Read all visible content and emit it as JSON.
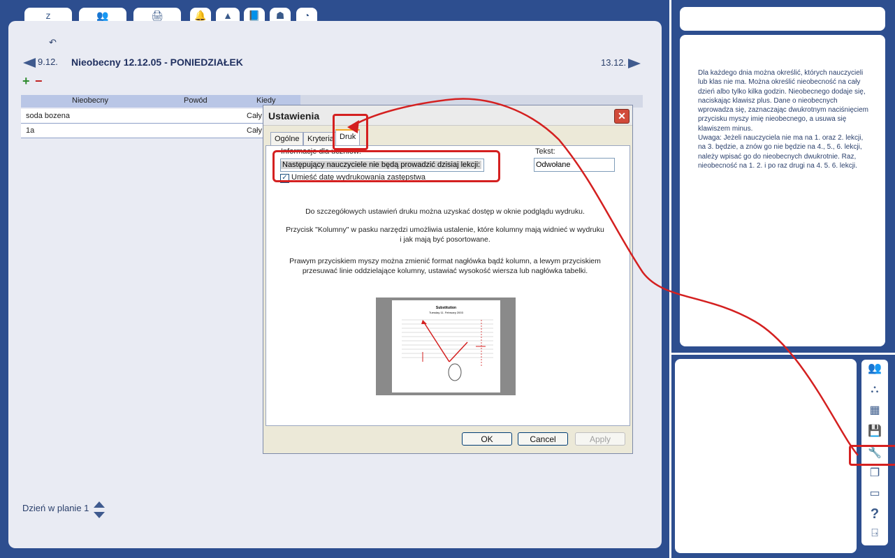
{
  "main": {
    "undo_symbol": "↶",
    "prev_day": "9.12.",
    "next_day": "13.12.",
    "title": "Nieobecny 12.12.05 - PONIEDZIAŁEK",
    "plus": "+",
    "minus": "−",
    "table": {
      "headers": [
        "Nieobecny",
        "Powód",
        "Kiedy"
      ],
      "rows": [
        {
          "name": "soda bozena",
          "when": "Cały"
        },
        {
          "name": "1a",
          "when": "Cały"
        }
      ]
    },
    "day_plan": "Dzień w planie 1"
  },
  "tabs": [
    {
      "icon": "sleep-icon",
      "symbol": "z"
    },
    {
      "icon": "teachers-icon",
      "symbol": "👥"
    },
    {
      "icon": "printer-icon",
      "symbol": "🖨"
    },
    {
      "icon": "bell-icon",
      "symbol": "🔔"
    },
    {
      "icon": "desk-icon",
      "symbol": "▲"
    },
    {
      "icon": "book-icon",
      "symbol": "📘"
    },
    {
      "icon": "person-icon",
      "symbol": "☗"
    },
    {
      "icon": "clock-icon",
      "symbol": "◔"
    }
  ],
  "dialog": {
    "title": "Ustawienia",
    "close": "✕",
    "tabs": [
      "Ogólne",
      "Kryteria",
      "Druk"
    ],
    "info_label": "Informacje dla uczniów:",
    "info_value": "Następujący nauczyciele nie będą prowadzić dzisiaj lekcji:",
    "tekst_label": "Tekst:",
    "tekst_value": "Odwołane",
    "checkbox_label": "Umieść datę wydrukowania zastępstwa",
    "checkbox_checked": true,
    "checkbox_mark": "✓",
    "para1": "Do szczegółowych ustawień druku można uzyskać dostęp w oknie podglądu wydruku.",
    "para2": "Przycisk \"Kolumny\" w pasku narzędzi umożliwia ustalenie, które kolumny mają widnieć w wydruku i jak mają być posortowane.",
    "para3": "Prawym przyciskiem myszy można zmienić format nagłówka bądź kolumn, a lewym przyciskiem przesuwać linie oddzielające kolumny, ustawiać wysokość wiersza lub nagłówka tabelki.",
    "preview_title": "Substitution",
    "preview_subtitle": "Tuesday 11. February 2003",
    "ok": "OK",
    "cancel": "Cancel",
    "apply": "Apply"
  },
  "help": {
    "text": "Dla każdego dnia można określić, których nauczycieli lub klas nie ma. Można określić nieobecność na cały dzień albo tylko kilka godzin. Nieobecnego dodaje się, naciskając klawisz plus. Dane o nieobecnych wprowadza się, zaznaczając dwukrotnym naciśnięciem przycisku myszy imię nieobecnego, a usuwa się klawiszem minus.\n Uwaga: Jeżeli nauczyciela nie ma na 1. oraz 2. lekcji, na 3. będzie, a znów go nie będzie na 4., 5., 6. lekcji, należy wpisać go do nieobecnych dwukrotnie. Raz, nieobecność na 1. 2. i po raz drugi na 4. 5. 6. lekcji."
  },
  "toolbar": [
    {
      "icon": "teachers-icon",
      "symbol": "👥"
    },
    {
      "icon": "classes-icon",
      "symbol": "⛬"
    },
    {
      "icon": "table-icon",
      "symbol": "▦"
    },
    {
      "icon": "save-icon",
      "symbol": "💾"
    },
    {
      "icon": "settings-tools-icon",
      "symbol": "🔧"
    },
    {
      "icon": "windows-icon",
      "symbol": "❐"
    },
    {
      "icon": "window-icon",
      "symbol": "▭"
    },
    {
      "icon": "help-icon",
      "symbol": "?"
    },
    {
      "icon": "exit-icon",
      "symbol": "⍈"
    }
  ],
  "colors": {
    "background": "#2d4e8f",
    "annotation": "#d42020",
    "title_text": "#1f2f5f",
    "active_tab_accent": "#f5a623"
  }
}
